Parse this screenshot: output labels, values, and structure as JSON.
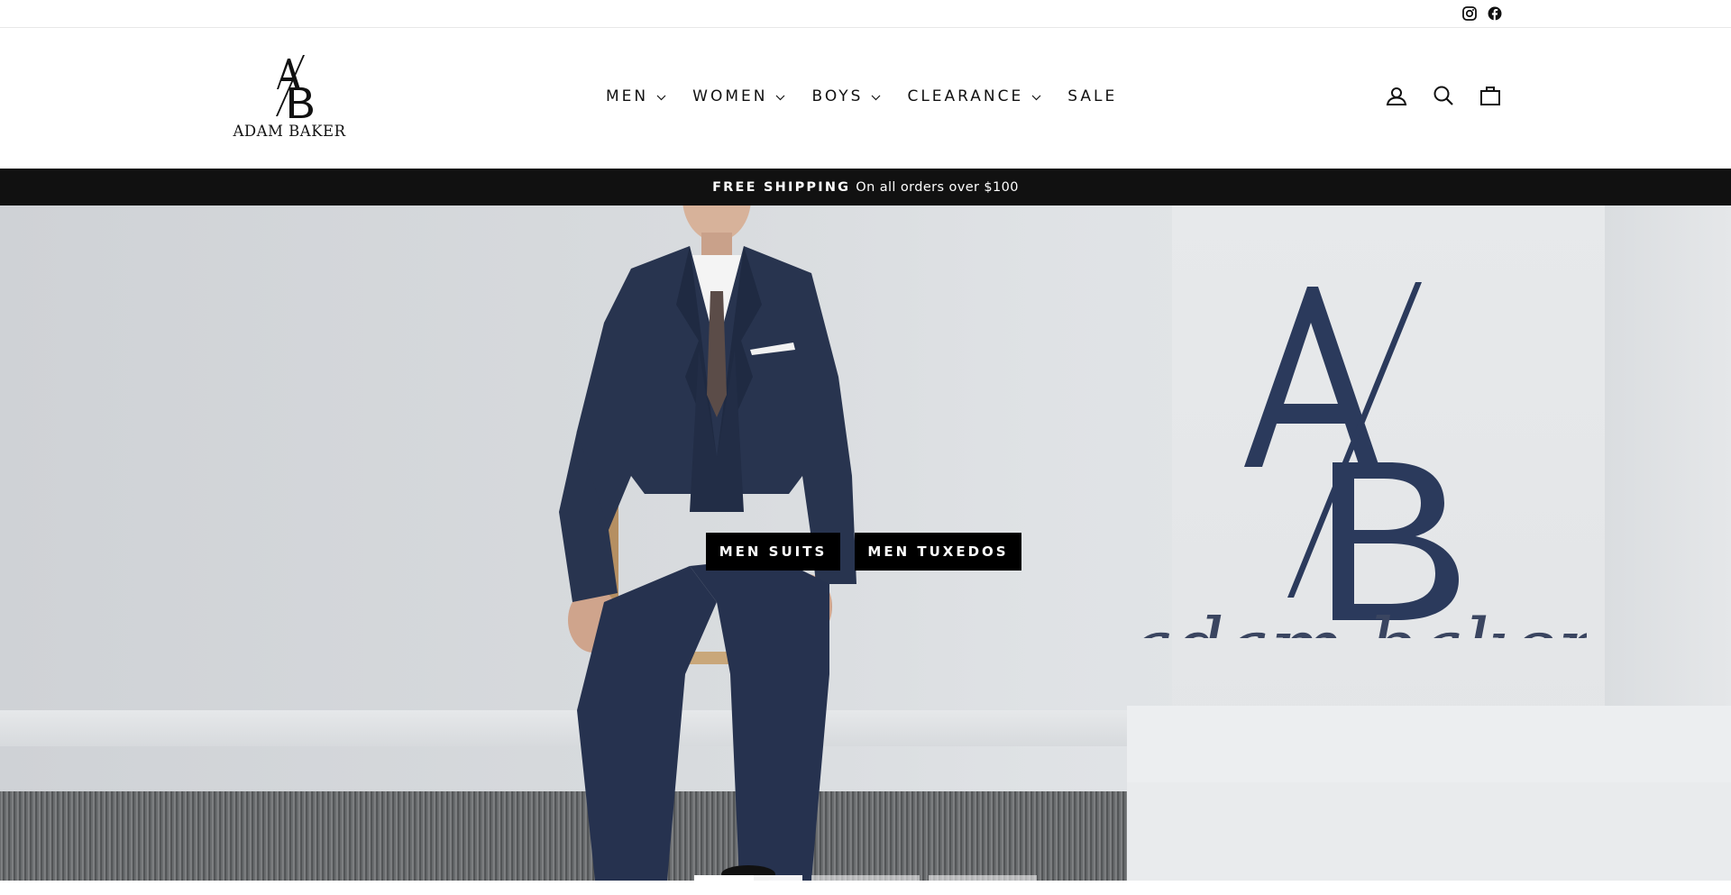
{
  "brand": {
    "logo_monogram": "A/B",
    "logo_text": "ADAM BAKER",
    "hero_script": "adam baker"
  },
  "social": [
    {
      "name": "instagram-icon"
    },
    {
      "name": "facebook-icon"
    }
  ],
  "nav": {
    "items": [
      {
        "label": "MEN",
        "has_dropdown": true
      },
      {
        "label": "WOMEN",
        "has_dropdown": true
      },
      {
        "label": "BOYS",
        "has_dropdown": true
      },
      {
        "label": "CLEARANCE",
        "has_dropdown": true
      },
      {
        "label": "SALE",
        "has_dropdown": false
      }
    ]
  },
  "header_icons": [
    "account-icon",
    "search-icon",
    "cart-icon"
  ],
  "announcement": {
    "strong": "FREE SHIPPING",
    "text": "On all orders over $100"
  },
  "hero": {
    "buttons": [
      {
        "label": "MEN SUITS"
      },
      {
        "label": "MEN TUXEDOS"
      }
    ],
    "slides": [
      {
        "progress": 0.55,
        "active": true
      },
      {
        "progress": 0,
        "active": false
      },
      {
        "progress": 0,
        "active": false
      }
    ]
  },
  "colors": {
    "announcement_bg": "#111111",
    "button_bg": "#000000",
    "suit_navy": "#26324f",
    "logo_navy": "#2b3a5c"
  }
}
